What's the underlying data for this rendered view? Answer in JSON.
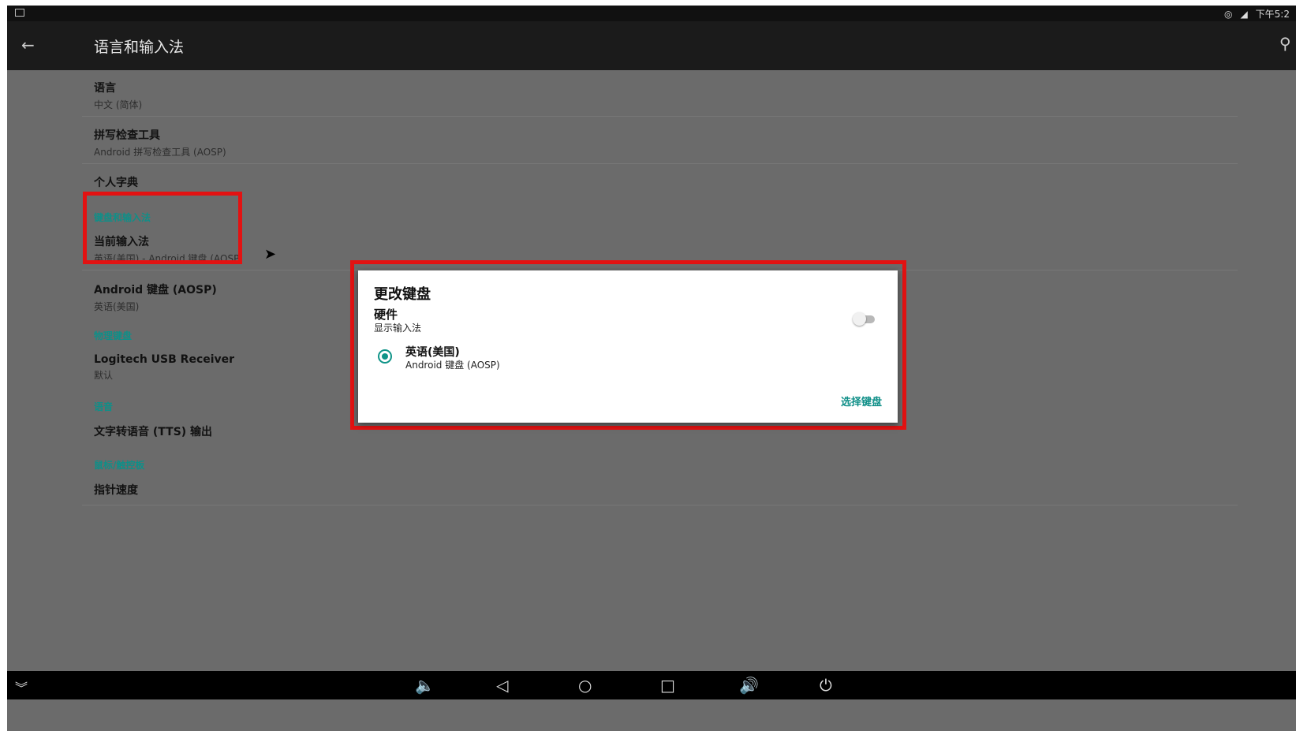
{
  "status_bar": {
    "time": "下午5:2"
  },
  "app_bar": {
    "title": "语言和输入法"
  },
  "settings": {
    "language": {
      "title": "语言",
      "subtitle": "中文 (简体)"
    },
    "spell_checker": {
      "title": "拼写检查工具",
      "subtitle": "Android 拼写检查工具 (AOSP)"
    },
    "personal_dictionary": {
      "title": "个人字典"
    },
    "section_keyboard": "键盘和输入法",
    "current_ime": {
      "title": "当前输入法",
      "subtitle": "英语(美国) - Android 键盘 (AOSP)"
    },
    "android_keyboard": {
      "title": "Android 键盘 (AOSP)",
      "subtitle": "英语(美国)"
    },
    "section_physical": "物理键盘",
    "logitech": {
      "title": "Logitech USB Receiver",
      "subtitle": "默认"
    },
    "section_speech": "语音",
    "tts": {
      "title": "文字转语音 (TTS) 输出"
    },
    "section_mouse": "鼠标/触控板",
    "pointer_speed": {
      "title": "指针速度"
    }
  },
  "dialog": {
    "title": "更改键盘",
    "hardware_title": "硬件",
    "hardware_subtitle": "显示输入法",
    "hardware_toggle_on": false,
    "option_title": "英语(美国)",
    "option_subtitle": "Android 键盘 (AOSP)",
    "option_selected": true,
    "choose_button": "选择键盘"
  },
  "colors": {
    "accent": "#0f8f88",
    "highlight": "#e21212"
  }
}
